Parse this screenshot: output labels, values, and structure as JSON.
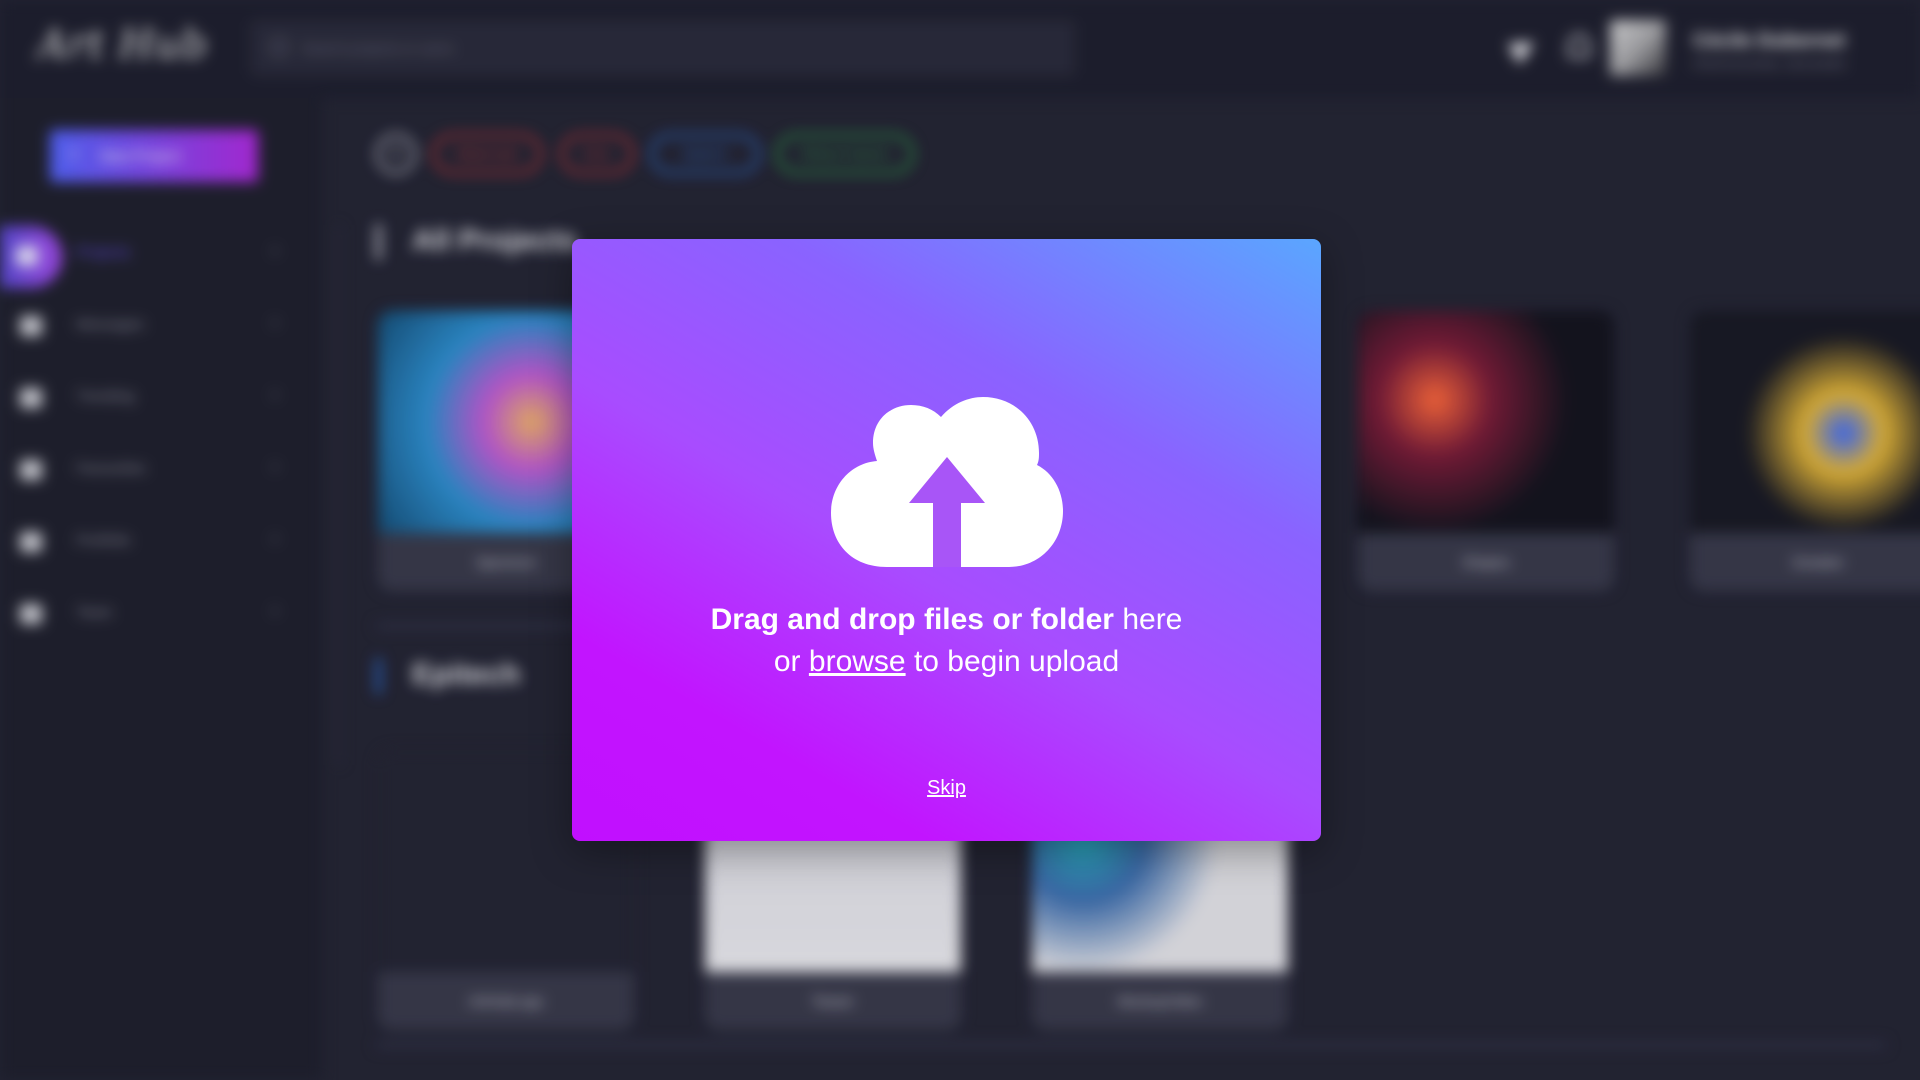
{
  "app": {
    "logo_text": "Art Hub",
    "search_placeholder": "Search projects or users",
    "user": {
      "name": "Cécile Dubernet",
      "role": "PROFESSIONAL DESIGNER"
    }
  },
  "sidebar": {
    "new_project_label": "New Project",
    "items": [
      {
        "label": "Projects",
        "icon": "chart-icon",
        "active": true
      },
      {
        "label": "Messages",
        "icon": "message-icon",
        "active": false
      },
      {
        "label": "Trending",
        "icon": "trending-icon",
        "active": false
      },
      {
        "label": "Favourites",
        "icon": "heart-icon",
        "active": false
      },
      {
        "label": "Portfolio",
        "icon": "eye-icon",
        "active": false
      },
      {
        "label": "Team",
        "icon": "user-icon",
        "active": false
      }
    ]
  },
  "filters": {
    "add_label": "+",
    "tags": [
      {
        "label": "Watermark",
        "color": "#d23a3a"
      },
      {
        "label": "Ecto",
        "color": "#d23a3a"
      },
      {
        "label": "Epitech",
        "color": "#2f6fd6"
      },
      {
        "label": "Reboot Games",
        "color": "#2fa84a"
      }
    ]
  },
  "sections": [
    {
      "title": "All Projects",
      "accent": "#d0d0da",
      "cards": [
        "Spectrum",
        "Shapes",
        "Sneaker"
      ]
    },
    {
      "title": "Epitech",
      "accent": "#2f6fd6",
      "cards": [
        "ArtHubLogo",
        "Teaser",
        "MockupVideo"
      ]
    }
  ],
  "modal": {
    "bold_text": "Drag and drop files or folder",
    "text_after_bold": " here",
    "line2_before": "or ",
    "browse_label": "browse",
    "line2_after": " to begin upload",
    "skip_label": "Skip",
    "icon": "cloud-upload-icon"
  }
}
